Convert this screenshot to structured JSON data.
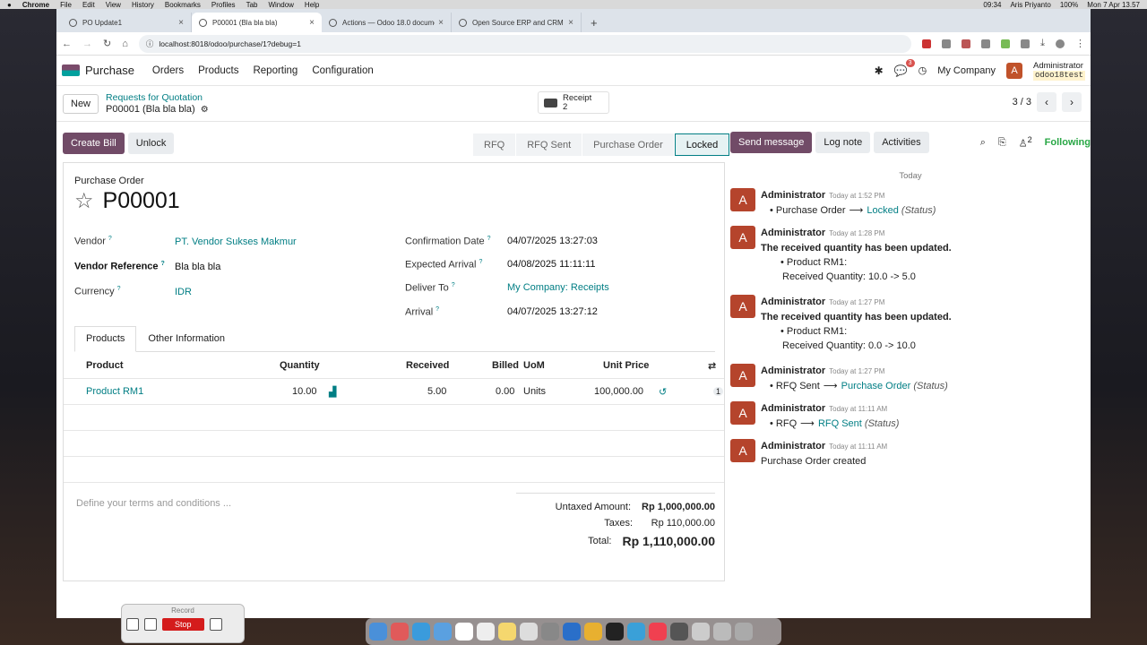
{
  "menubar": {
    "app": "Chrome",
    "items": [
      "File",
      "Edit",
      "View",
      "History",
      "Bookmarks",
      "Profiles",
      "Tab",
      "Window",
      "Help"
    ],
    "time": "09:34",
    "user": "Aris Priyanto",
    "battery": "100%",
    "datetime": "Mon 7 Apr 13.57"
  },
  "browser": {
    "tabs": [
      {
        "title": "PO Update1"
      },
      {
        "title": "P00001 (Bla bla bla)"
      },
      {
        "title": "Actions — Odoo 18.0 documen"
      },
      {
        "title": "Open Source ERP and CRM | "
      }
    ],
    "url": "localhost:8018/odoo/purchase/1?debug=1"
  },
  "odoo": {
    "app": "Purchase",
    "menu": [
      "Orders",
      "Products",
      "Reporting",
      "Configuration"
    ],
    "chat_count": "3",
    "company": "My Company",
    "user_initial": "A",
    "user": "Administrator",
    "db": "odoo18test"
  },
  "cp": {
    "new": "New",
    "breadcrumb_parent": "Requests for Quotation",
    "breadcrumb_current": "P00001 (Bla bla bla)",
    "receipt_label": "Receipt",
    "receipt_count": "2",
    "pager": "3 / 3"
  },
  "actions": {
    "create_bill": "Create Bill",
    "unlock": "Unlock"
  },
  "status": [
    "RFQ",
    "RFQ Sent",
    "Purchase Order",
    "Locked"
  ],
  "form": {
    "doc_type": "Purchase Order",
    "number": "P00001",
    "vendor_lbl": "Vendor",
    "vendor": "PT. Vendor Sukses Makmur",
    "vref_lbl": "Vendor Reference",
    "vref": "Bla bla bla",
    "currency_lbl": "Currency",
    "currency": "IDR",
    "conf_lbl": "Confirmation Date",
    "conf": "04/07/2025 13:27:03",
    "exp_lbl": "Expected Arrival",
    "exp": "04/08/2025 11:11:11",
    "deliver_lbl": "Deliver To",
    "deliver": "My Company: Receipts",
    "arrival_lbl": "Arrival",
    "arrival": "04/07/2025 13:27:12",
    "help": "?"
  },
  "nb_tabs": [
    "Products",
    "Other Information"
  ],
  "lines": {
    "headers": {
      "product": "Product",
      "qty": "Quantity",
      "received": "Received",
      "billed": "Billed",
      "uom": "UoM",
      "price": "Unit Price"
    },
    "rows": [
      {
        "product": "Product RM1",
        "qty": "10.00",
        "received": "5.00",
        "billed": "0.00",
        "uom": "Units",
        "price": "100,000.00",
        "extra": "1"
      }
    ]
  },
  "terms_placeholder": "Define your terms and conditions ...",
  "totals": {
    "untaxed_lbl": "Untaxed Amount:",
    "untaxed": "Rp 1,000,000.00",
    "taxes_lbl": "Taxes:",
    "taxes": "Rp 110,000.00",
    "total_lbl": "Total:",
    "total": "Rp 1,110,000.00"
  },
  "chatter": {
    "send": "Send message",
    "log": "Log note",
    "activities": "Activities",
    "followers": "2",
    "following": "Following",
    "today": "Today",
    "messages": [
      {
        "author": "Administrator",
        "time": "Today at 1:52 PM",
        "old": "Purchase Order",
        "new": "Locked",
        "field": "(Status)"
      },
      {
        "author": "Administrator",
        "time": "Today at 1:28 PM",
        "text": "The received quantity has been updated.",
        "item": "Product RM1:",
        "detail": "Received Quantity: 10.0 -> 5.0"
      },
      {
        "author": "Administrator",
        "time": "Today at 1:27 PM",
        "text": "The received quantity has been updated.",
        "item": "Product RM1:",
        "detail": "Received Quantity: 0.0 -> 10.0"
      },
      {
        "author": "Administrator",
        "time": "Today at 1:27 PM",
        "old": "RFQ Sent",
        "new": "Purchase Order",
        "field": "(Status)"
      },
      {
        "author": "Administrator",
        "time": "Today at 11:11 AM",
        "old": "RFQ",
        "new": "RFQ Sent",
        "field": "(Status)"
      },
      {
        "author": "Administrator",
        "time": "Today at 11:11 AM",
        "text": "Purchase Order created"
      }
    ]
  },
  "recorder": {
    "title": "Record",
    "stop": "Stop"
  }
}
